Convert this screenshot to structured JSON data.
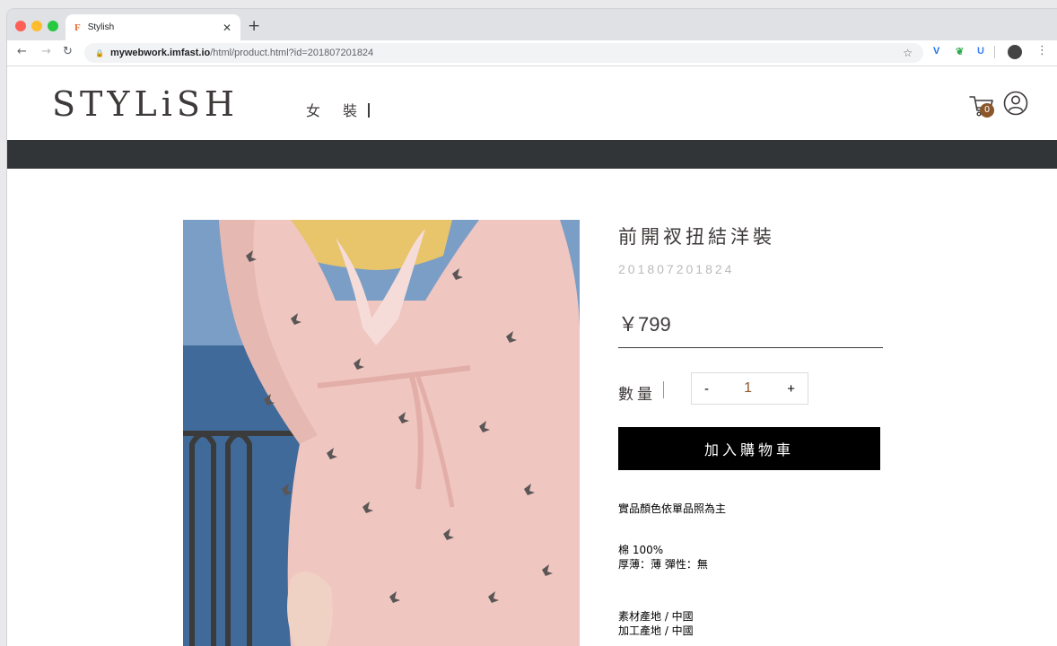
{
  "browser": {
    "tab_title": "Stylish",
    "tab_favicon": "F",
    "url_host": "mywebwork.imfast.io",
    "url_path": "/html/product.html?id=201807201824"
  },
  "site": {
    "logo": "STYLiSH",
    "nav": {
      "women": "女 裝"
    },
    "cart_count": "0"
  },
  "product": {
    "title": "前開衩扭結洋裝",
    "id": "201807201824",
    "price": "￥799",
    "quantity_label": "數量",
    "quantity": "1",
    "minus": "-",
    "plus": "+",
    "add_to_cart": "加入購物車",
    "note": "實品顏色依單品照為主",
    "material": [
      "棉 100%",
      "厚薄：薄 彈性：無"
    ],
    "origin": [
      "素材產地 / 中國",
      "加工產地 / 中國"
    ]
  },
  "colors": {
    "brand_text": "#3f3a3a",
    "nav_bar": "#313538",
    "badge": "#8b572a",
    "button": "#000000"
  },
  "icons": {
    "cart": "cart-icon",
    "member": "member-icon",
    "lock": "lock-icon",
    "star": "star-icon"
  }
}
